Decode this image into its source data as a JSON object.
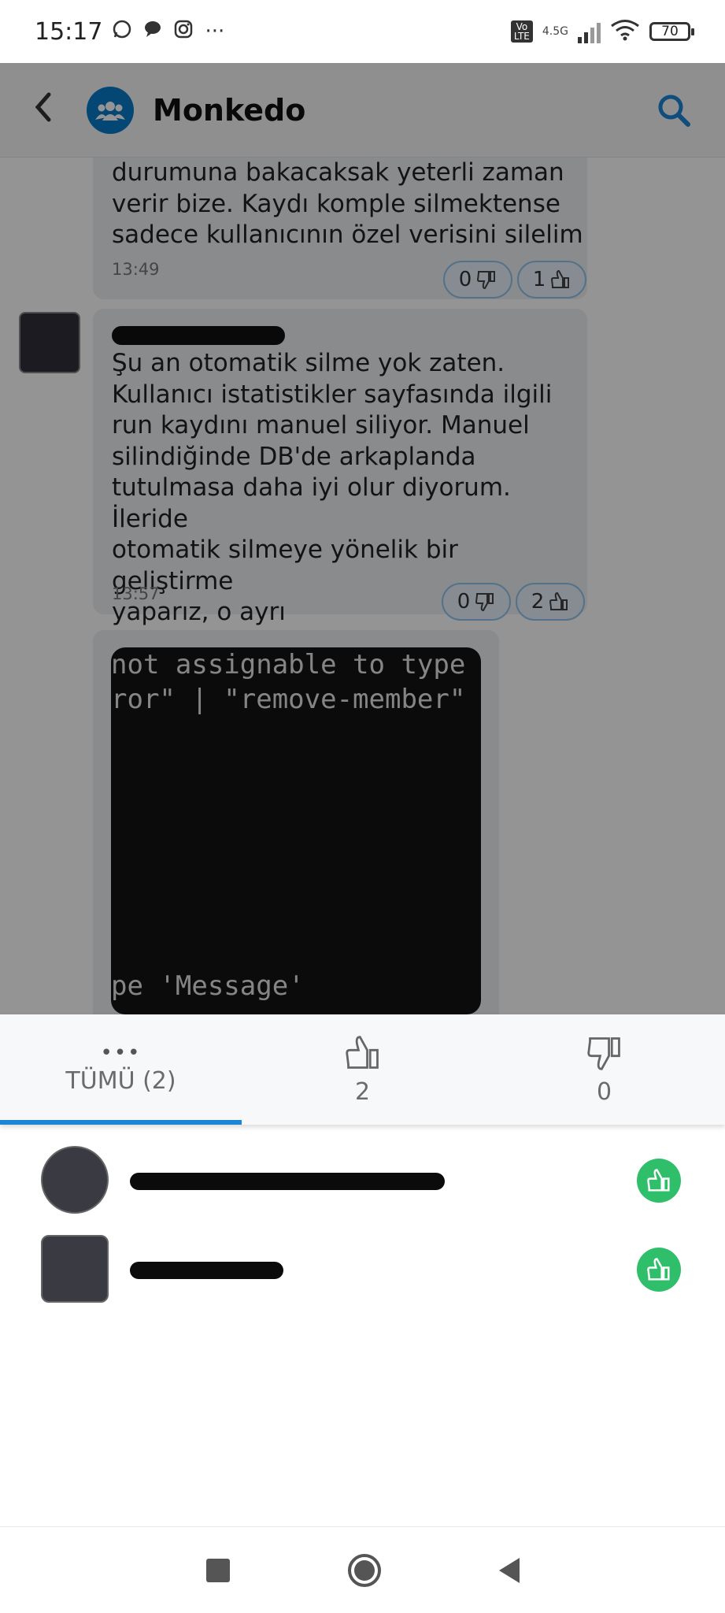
{
  "status_bar": {
    "time": "15:17",
    "more": "···",
    "network": "4.5G",
    "battery": "70"
  },
  "app_bar": {
    "title": "Monkedo"
  },
  "messages": [
    {
      "lines": [
        "durumuna bakacaksak yeterli zaman",
        "verir bize. Kaydı komple silmektense",
        "sadece kullanıcının özel verisini silelim"
      ],
      "time": "13:49",
      "dislikes": "0",
      "likes": "1"
    },
    {
      "lines": [
        "Şu an otomatik silme yok zaten.",
        "Kullanıcı istatistikler sayfasında ilgili",
        "run kaydını manuel siliyor. Manuel",
        "silindiğinde DB'de arkaplanda",
        "tutulmasa daha iyi olur diyorum. İleride",
        "otomatik silmeye yönelik bir geliştirme",
        "yaparız, o ayrı"
      ],
      "time": "13:57",
      "dislikes": "0",
      "likes": "2"
    }
  ],
  "code_image": {
    "lines": [
      " not assignable to type",
      "ror\" | \"remove-member\"",
      "pe 'Message'"
    ]
  },
  "reactions_sheet": {
    "tabs": [
      {
        "label": "TÜMÜ (2)",
        "icon": "more-dots-icon"
      },
      {
        "label": "2",
        "icon": "thumbs-up-icon"
      },
      {
        "label": "0",
        "icon": "thumbs-down-icon"
      }
    ],
    "reactors": [
      {
        "reaction": "thumbs-up-icon"
      },
      {
        "reaction": "thumbs-up-icon"
      }
    ]
  },
  "colors": {
    "accent": "#1b85d6",
    "like_green": "#2fbf6a",
    "group_avatar": "#0a7ac9"
  }
}
